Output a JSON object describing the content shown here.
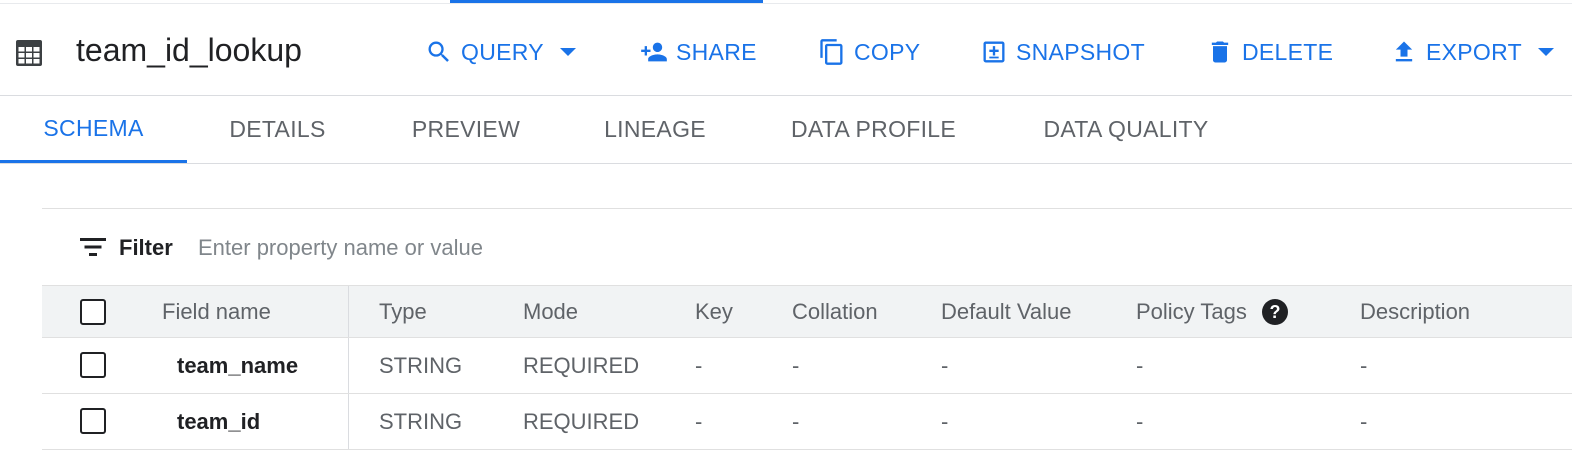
{
  "header": {
    "title": "team_id_lookup",
    "actions": {
      "query": "QUERY",
      "share": "SHARE",
      "copy": "COPY",
      "snapshot": "SNAPSHOT",
      "delete": "DELETE",
      "export": "EXPORT"
    }
  },
  "tabs": [
    "SCHEMA",
    "DETAILS",
    "PREVIEW",
    "LINEAGE",
    "DATA PROFILE",
    "DATA QUALITY"
  ],
  "active_tab": "SCHEMA",
  "filter": {
    "label": "Filter",
    "placeholder": "Enter property name or value"
  },
  "table": {
    "columns": [
      "Field name",
      "Type",
      "Mode",
      "Key",
      "Collation",
      "Default Value",
      "Policy Tags",
      "Description"
    ],
    "rows": [
      [
        "team_name",
        "STRING",
        "REQUIRED",
        "-",
        "-",
        "-",
        "-",
        "-"
      ],
      [
        "team_id",
        "STRING",
        "REQUIRED",
        "-",
        "-",
        "-",
        "-",
        "-"
      ]
    ]
  },
  "colors": {
    "accent": "#1a73e8",
    "text": "#202124",
    "muted": "#5f6368",
    "header_bg": "#f1f3f4"
  },
  "icons": {
    "table": "table-grid-icon",
    "query": "search-icon",
    "share": "person-add-icon",
    "copy": "copy-icon",
    "snapshot": "snapshot-icon",
    "delete": "trash-icon",
    "export": "upload-icon",
    "filter": "filter-lines-icon",
    "policy_help": "help-circle-icon"
  }
}
